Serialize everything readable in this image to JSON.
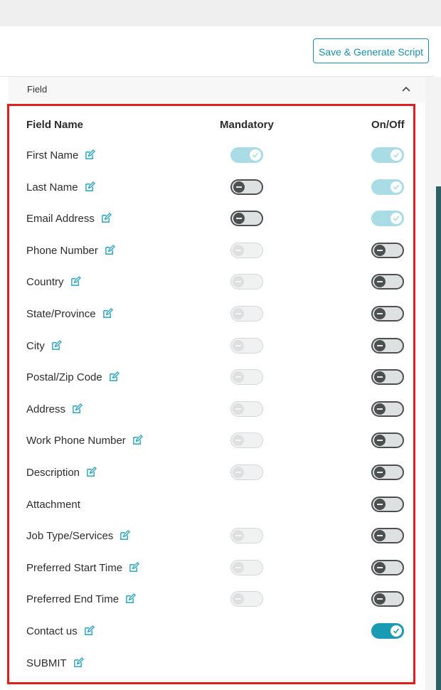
{
  "toolbar": {
    "save_label": "Save & Generate Script"
  },
  "section": {
    "title": "Field"
  },
  "table": {
    "headers": {
      "name": "Field Name",
      "mandatory": "Mandatory",
      "onoff": "On/Off"
    }
  },
  "colors": {
    "accent": "#1c8fa8",
    "toggle_on": "#1a9ab3",
    "toggle_on_disabled": "#a9dce5",
    "highlight": "#e01e1e"
  },
  "fields": [
    {
      "name": "First Name",
      "editable": true,
      "mandatory": "on-light",
      "onoff": "on-light"
    },
    {
      "name": "Last Name",
      "editable": true,
      "mandatory": "off-dark",
      "onoff": "on-light"
    },
    {
      "name": "Email Address",
      "editable": true,
      "mandatory": "off-dark",
      "onoff": "on-light"
    },
    {
      "name": "Phone Number",
      "editable": true,
      "mandatory": "off-light",
      "onoff": "off-dark"
    },
    {
      "name": "Country",
      "editable": true,
      "mandatory": "off-light",
      "onoff": "off-dark"
    },
    {
      "name": "State/Province",
      "editable": true,
      "mandatory": "off-light",
      "onoff": "off-dark"
    },
    {
      "name": "City",
      "editable": true,
      "mandatory": "off-light",
      "onoff": "off-dark"
    },
    {
      "name": "Postal/Zip Code",
      "editable": true,
      "mandatory": "off-light",
      "onoff": "off-dark"
    },
    {
      "name": "Address",
      "editable": true,
      "mandatory": "off-light",
      "onoff": "off-dark"
    },
    {
      "name": "Work Phone Number",
      "editable": true,
      "mandatory": "off-light",
      "onoff": "off-dark"
    },
    {
      "name": "Description",
      "editable": true,
      "mandatory": "off-light",
      "onoff": "off-dark"
    },
    {
      "name": "Attachment",
      "editable": false,
      "mandatory": "none",
      "onoff": "off-dark"
    },
    {
      "name": "Job Type/Services",
      "editable": true,
      "mandatory": "off-light",
      "onoff": "off-dark"
    },
    {
      "name": "Preferred Start Time",
      "editable": true,
      "mandatory": "off-light",
      "onoff": "off-dark"
    },
    {
      "name": "Preferred End Time",
      "editable": true,
      "mandatory": "off-light",
      "onoff": "off-dark"
    },
    {
      "name": "Contact us",
      "editable": true,
      "mandatory": "none",
      "onoff": "on-dark"
    },
    {
      "name": "SUBMIT",
      "editable": true,
      "mandatory": "none",
      "onoff": "none"
    }
  ]
}
